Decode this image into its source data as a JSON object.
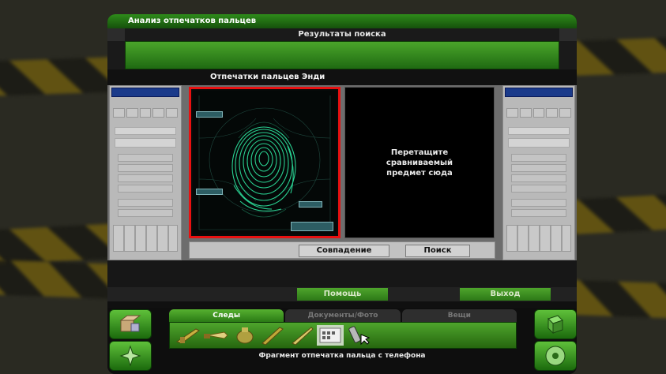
{
  "window": {
    "title": "Анализ отпечатков пальцев"
  },
  "results": {
    "header": "Результаты поиска"
  },
  "subtitle": "Отпечатки пальцев Энди",
  "drop_zone": {
    "text": "Перетащите\nсравниваемый\nпредмет сюда"
  },
  "actions": {
    "match_label": "Совпадение",
    "search_label": "Поиск"
  },
  "menu": {
    "help_label": "Помощь",
    "exit_label": "Выход"
  },
  "inventory": {
    "tabs": [
      {
        "label": "Следы",
        "active": true
      },
      {
        "label": "Документы/Фото",
        "active": false
      },
      {
        "label": "Вещи",
        "active": false
      }
    ],
    "items": [
      "rifle-icon",
      "knife-icon",
      "pouch-icon",
      "shotgun-icon",
      "blade-icon",
      "fingerprint-card-icon",
      "phone-icon"
    ]
  },
  "status_text": "Фрагмент отпечатка пальца с телефона",
  "colors": {
    "accent_green": "#4ea52c",
    "frame_red": "#e81010",
    "fingerprint": "#2ee6a0"
  }
}
